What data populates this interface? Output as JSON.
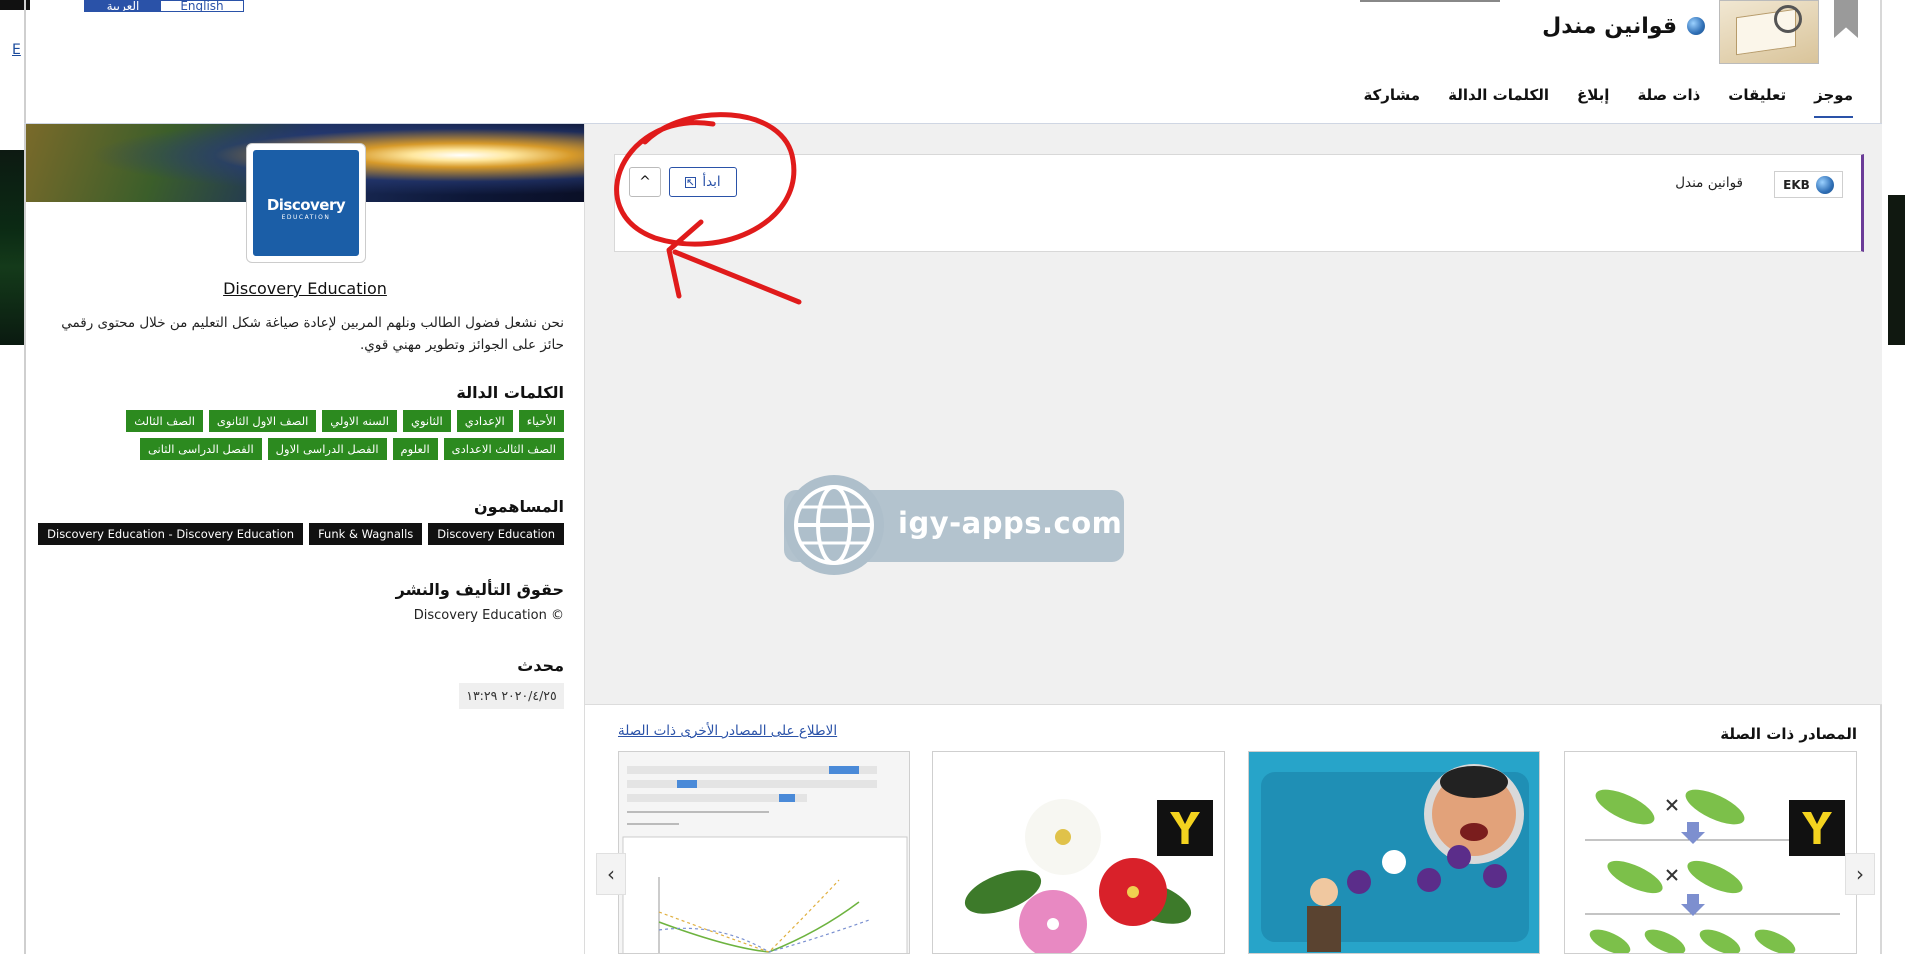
{
  "language": {
    "arabic": "العربية",
    "english": "English"
  },
  "header": {
    "title": "قوانين مندل"
  },
  "tabs": [
    {
      "label": "موجز",
      "active": true
    },
    {
      "label": "تعليقات"
    },
    {
      "label": "ذات صلة"
    },
    {
      "label": "إبلاغ"
    },
    {
      "label": "الكلمات الدالة"
    },
    {
      "label": "مشاركة"
    }
  ],
  "sidebar": {
    "logo": {
      "big": "Discovery",
      "small": "EDUCATION"
    },
    "org_name": "Discovery Education",
    "description": "نحن نشعل فضول الطالب ونلهم المربين لإعادة صياغة شكل التعليم من خلال محتوى رقمي حائز على الجوائز وتطوير مهني قوي.",
    "keywords_title": "الكلمات الدالة",
    "keywords": [
      "الأحياء",
      "الإعدادي",
      "الثانوي",
      "السنه الاولي",
      "الصف الاول الثانوى",
      "الصف الثالث",
      "الصف الثالث الاعدادى",
      "العلوم",
      "الفصل الدراسى الاول",
      "الفصل الدراسى الثانى"
    ],
    "contributors_title": "المساهمون",
    "contributors": [
      "Discovery Education",
      "Funk & Wagnalls",
      "Discovery Education - Discovery Education"
    ],
    "copyright_title": "حقوق التأليف والنشر",
    "copyright_text": "© Discovery Education",
    "updated_title": "محدث",
    "updated_value": "٢٠٢٠/٤/٢٥ ١٣:٢٩"
  },
  "player": {
    "ekb_label": "EKB",
    "title": "قوانين مندل",
    "start_label": "ابدأ",
    "start_icon": "external-link-icon",
    "collapse_icon": "chevron-up-icon",
    "collapse_glyph": "^"
  },
  "watermark": {
    "text": "igy-apps.com"
  },
  "related": {
    "title": "المصادر ذات الصلة",
    "more_link": "الاطلاع على المصادر الأخرى ذات الصلة",
    "prev_glyph": "‹",
    "next_glyph": "›"
  },
  "colors": {
    "accent": "#2a52a8",
    "keyword_bg": "#2c8a1f",
    "contributor_bg": "#111111",
    "annotation": "#e01b1b",
    "player_border": "#6b3c98"
  }
}
